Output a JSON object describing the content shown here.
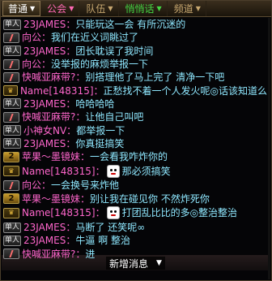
{
  "colors": {
    "tab_active_text": "#ffffff",
    "tab_guild_text": "#ff69b4",
    "tab_team_text": "#c8a870",
    "tab_chat_text": "#44d844",
    "tab_channel_text": "#c8a870",
    "system_name": "#ff66cc",
    "player_name": "#ff66cc",
    "message_text": "#8fe8ff"
  },
  "tabs": [
    {
      "label": "普通",
      "active": true
    },
    {
      "label": "公会",
      "active": false
    },
    {
      "label": "队伍",
      "active": false
    },
    {
      "label": "悄悄话",
      "active": false
    },
    {
      "label": "频道",
      "active": false
    }
  ],
  "tab_arrow_icon": "triangle-down-icon",
  "messages": [
    {
      "badge": "单人",
      "badge_type": "solo",
      "sender": "23JAMES：",
      "text": "只能玩这一会  有所沉迷的"
    },
    {
      "badge": "",
      "badge_type": "slash",
      "sender": "向公：",
      "text": "我们在近义词眺过了"
    },
    {
      "badge": "单人",
      "badge_type": "solo",
      "sender": "23JAMES：",
      "text": "团长耽误了我时间"
    },
    {
      "badge": "",
      "badge_type": "slash",
      "sender": "向公：",
      "text": "没举报的麻烦举报一下"
    },
    {
      "badge": "",
      "badge_type": "slash",
      "sender": "快喊亚麻带?：",
      "text": "别搭理他了马上完了 清净一下吧"
    },
    {
      "badge": "vip",
      "badge_type": "vip",
      "sender": "Name[148315]：",
      "text": "正愁找不着一个人发火呢◎话该知道么"
    },
    {
      "badge": "单人",
      "badge_type": "solo",
      "sender": "23JAMES：",
      "text": "哈哈哈哈"
    },
    {
      "badge": "",
      "badge_type": "slash",
      "sender": "快喊亚麻带?：",
      "text": "让他自己叫吧"
    },
    {
      "badge": "单人",
      "badge_type": "solo",
      "sender": "小神女NV：",
      "text": "都举报一下"
    },
    {
      "badge": "单人",
      "badge_type": "solo",
      "sender": "23JAMES：",
      "text": "你真挺搞笑"
    },
    {
      "badge": "2",
      "badge_type": "team",
      "sender": "苹果～墨镜妹：",
      "text": "一会看我咋炸你的"
    },
    {
      "badge": "vip",
      "badge_type": "vip",
      "sender": "Name[148315]：",
      "text": "那必须搞笑",
      "emote": true
    },
    {
      "badge": "",
      "badge_type": "slash",
      "sender": "向公：",
      "text": "一会换号来炸他"
    },
    {
      "badge": "2",
      "badge_type": "team",
      "sender": "苹果～墨镜妹：",
      "text": "别让我在碰见你 不然炸死你"
    },
    {
      "badge": "vip",
      "badge_type": "vip",
      "sender": "Name[148315]：",
      "text": "打团乱比比的多◎整治整治",
      "emote": true
    },
    {
      "badge": "单人",
      "badge_type": "solo",
      "sender": "23JAMES：",
      "text": "马断了 还笑呢∞"
    },
    {
      "badge": "单人",
      "badge_type": "solo",
      "sender": "23JAMES：",
      "text": "牛逼 啊 整治"
    },
    {
      "badge": "",
      "badge_type": "slash",
      "sender": "快喊亚麻带?：",
      "text": "进"
    }
  ],
  "bottom_bar": {
    "label": "新增消息",
    "arrow_icon": "triangle-down-icon"
  }
}
